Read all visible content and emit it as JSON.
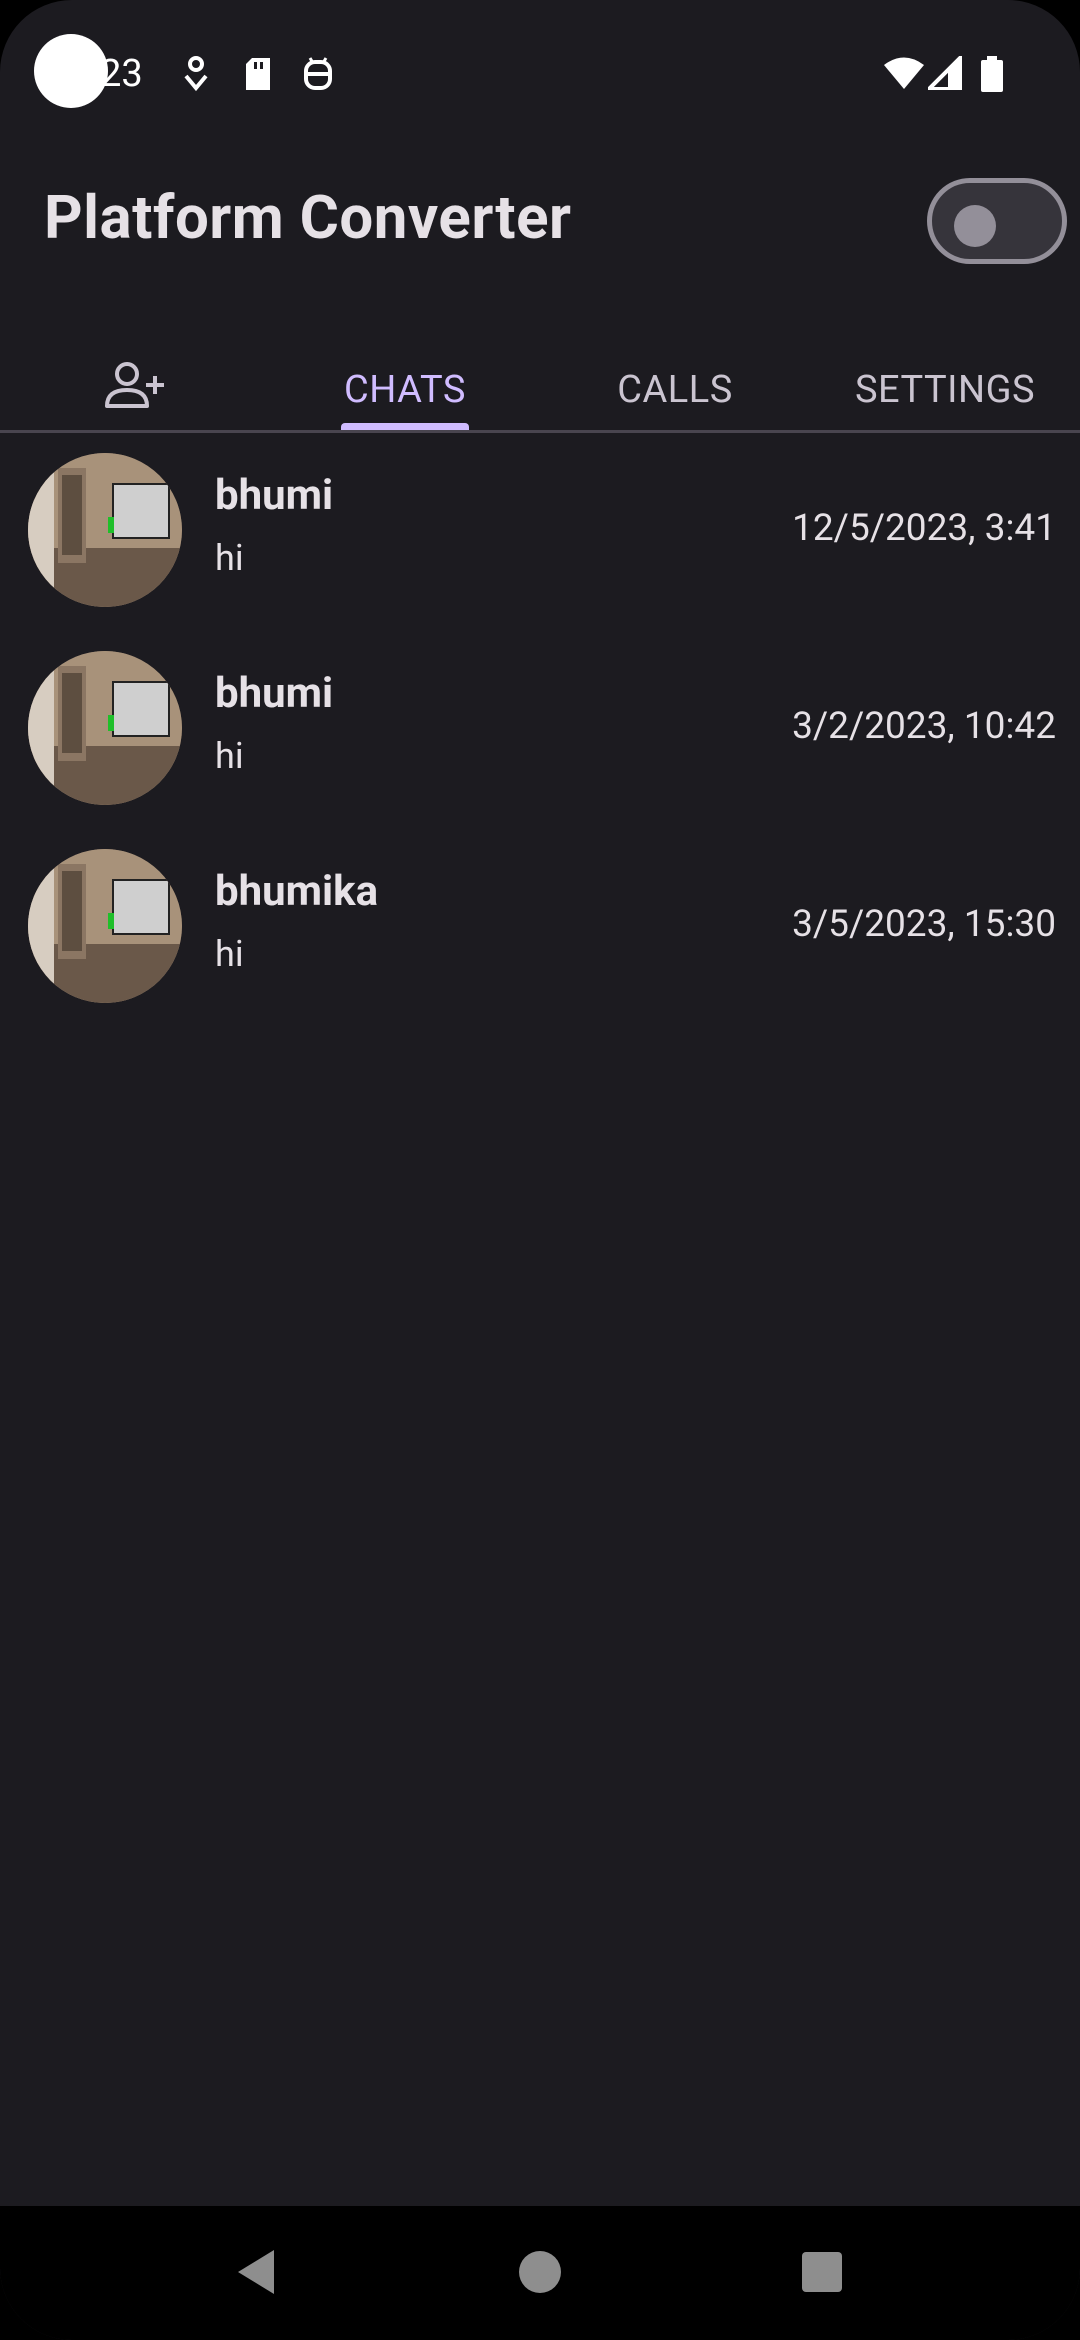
{
  "status_bar": {
    "time": "23",
    "icons": [
      "navigation-icon",
      "sd-card-icon",
      "android-debug-icon",
      "wifi-icon",
      "cell-signal-icon",
      "battery-icon"
    ]
  },
  "header": {
    "title": "Platform Converter",
    "theme_toggle_on": false
  },
  "tabs": [
    {
      "icon": "add-contact-icon"
    },
    {
      "label": "CHATS",
      "active": true
    },
    {
      "label": "CALLS"
    },
    {
      "label": "SETTINGS"
    }
  ],
  "chats": [
    {
      "name": "bhumi",
      "message": "hi",
      "time": "12/5/2023, 3:41"
    },
    {
      "name": "bhumi",
      "message": "hi",
      "time": "3/2/2023, 10:42"
    },
    {
      "name": "bhumika",
      "message": "hi",
      "time": "3/5/2023, 15:30"
    }
  ],
  "nav_bar": {
    "buttons": [
      "back-icon",
      "home-icon",
      "recents-icon"
    ]
  },
  "colors": {
    "background": "#1c1b20",
    "accent": "#d0bcff",
    "text": "#e6e1e6",
    "secondary_text": "#cac4d0"
  }
}
